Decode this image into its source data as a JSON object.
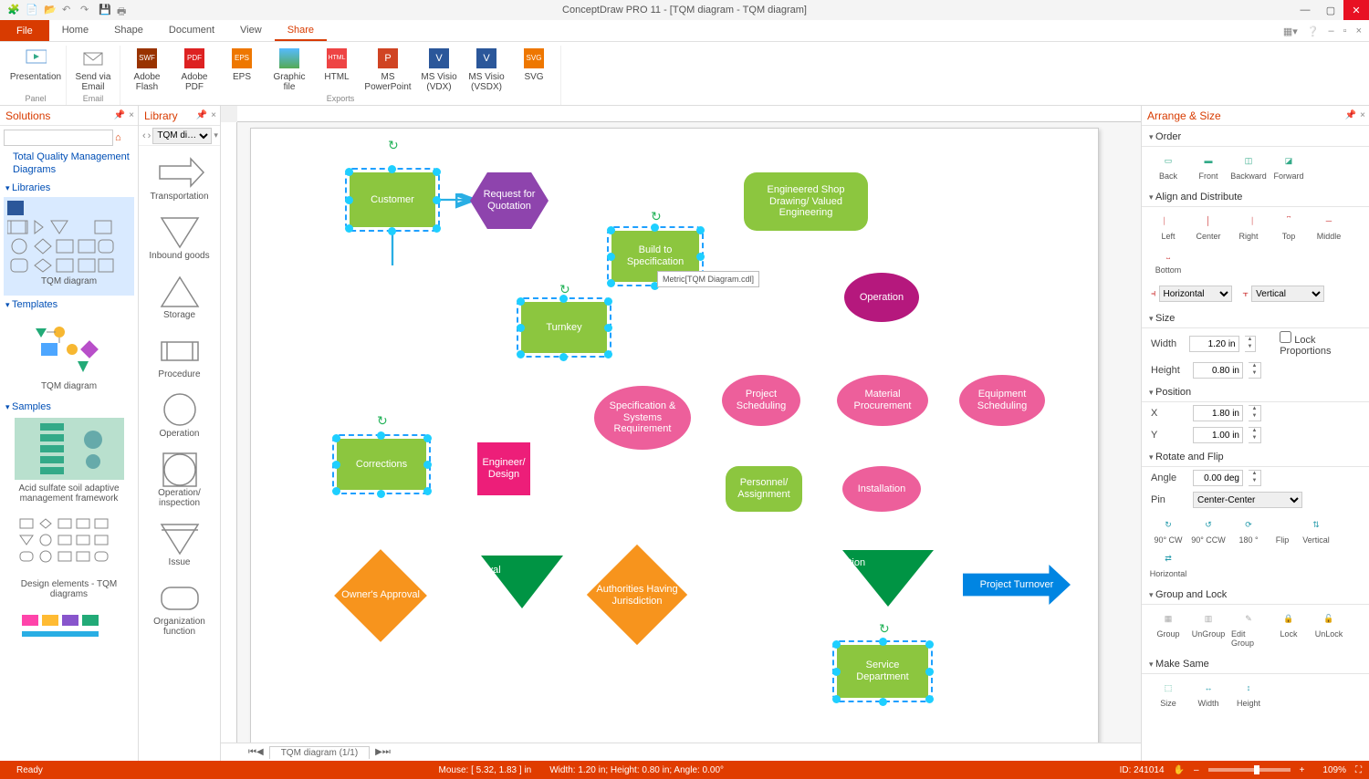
{
  "titlebar": {
    "title": "ConceptDraw PRO 11 - [TQM diagram - TQM diagram]"
  },
  "ribbon": {
    "file": "File",
    "tabs": [
      "Home",
      "Shape",
      "Document",
      "View",
      "Share"
    ],
    "active_tab": "Share",
    "groups": {
      "panel": {
        "label": "Panel",
        "items": [
          "Presentation"
        ]
      },
      "email": {
        "label": "Email",
        "items": [
          "Send via Email"
        ]
      },
      "exports": {
        "label": "Exports",
        "items": [
          "Adobe Flash",
          "Adobe PDF",
          "EPS",
          "Graphic file",
          "HTML",
          "MS PowerPoint",
          "MS Visio (VDX)",
          "MS Visio (VSDX)",
          "SVG"
        ]
      }
    }
  },
  "solutions": {
    "title": "Solutions",
    "root_link": "Total Quality Management Diagrams",
    "sections": {
      "libraries": "Libraries",
      "templates": "Templates",
      "samples": "Samples"
    },
    "library_thumb": "TQM diagram",
    "template_thumb": "TQM diagram",
    "sample1": "Acid sulfate soil adaptive management framework",
    "sample2": "Design elements - TQM diagrams"
  },
  "library": {
    "title": "Library",
    "selector": "TQM di…",
    "items": [
      "Transportation",
      "Inbound goods",
      "Storage",
      "Procedure",
      "Operation",
      "Operation/ inspection",
      "Issue",
      "Organization function"
    ]
  },
  "canvas": {
    "sheet_tab": "TQM diagram (1/1)",
    "tooltip": "Metric[TQM Diagram.cdl]",
    "nodes": {
      "customer": "Customer",
      "rfq": "Request for Quotation",
      "bts": "Build to Specification",
      "esd": "Engineered Shop Drawing/ Valued Engineering",
      "turnkey": "Turnkey",
      "operation": "Operation",
      "spec": "Specification & Systems Requirement",
      "proj": "Project Scheduling",
      "mat": "Material Procurement",
      "equip": "Equipment Scheduling",
      "corrections": "Corrections",
      "eng": "Engineer/ Design",
      "personnel": "Personnel/ Assignment",
      "install": "Installation",
      "owner": "Owner's Approval",
      "approval": "Approval",
      "auth": "Authorities Having Jurisdiction",
      "inspection": "Inspection",
      "turnover": "Project Turnover",
      "service": "Service Department"
    }
  },
  "arrange": {
    "title": "Arrange & Size",
    "sections": {
      "order": "Order",
      "align": "Align and Distribute",
      "size": "Size",
      "position": "Position",
      "rotate": "Rotate and Flip",
      "group": "Group and Lock",
      "same": "Make Same"
    },
    "order": {
      "back": "Back",
      "front": "Front",
      "backward": "Backward",
      "forward": "Forward"
    },
    "align": {
      "left": "Left",
      "center": "Center",
      "right": "Right",
      "top": "Top",
      "middle": "Middle",
      "bottom": "Bottom",
      "horizontal": "Horizontal",
      "vertical": "Vertical"
    },
    "size": {
      "width_label": "Width",
      "height_label": "Height",
      "lock": "Lock Proportions",
      "width": "1.20 in",
      "height": "0.80 in"
    },
    "position": {
      "x_label": "X",
      "y_label": "Y",
      "x": "1.80 in",
      "y": "1.00 in"
    },
    "rotate": {
      "angle_label": "Angle",
      "angle": "0.00 deg",
      "pin_label": "Pin",
      "pin": "Center-Center",
      "cw": "90° CW",
      "ccw": "90° CCW",
      "r180": "180 °",
      "flip": "Flip",
      "v": "Vertical",
      "h": "Horizontal"
    },
    "group": {
      "group": "Group",
      "ungroup": "UnGroup",
      "edit": "Edit Group",
      "lock": "Lock",
      "unlock": "UnLock"
    },
    "same": {
      "size": "Size",
      "width": "Width",
      "height": "Height"
    }
  },
  "status": {
    "ready": "Ready",
    "mouse": "Mouse: [ 5.32, 1.83 ] in",
    "dims": "Width: 1.20 in;  Height: 0.80 in;  Angle: 0.00°",
    "id": "ID: 241014",
    "zoom": "109%"
  }
}
